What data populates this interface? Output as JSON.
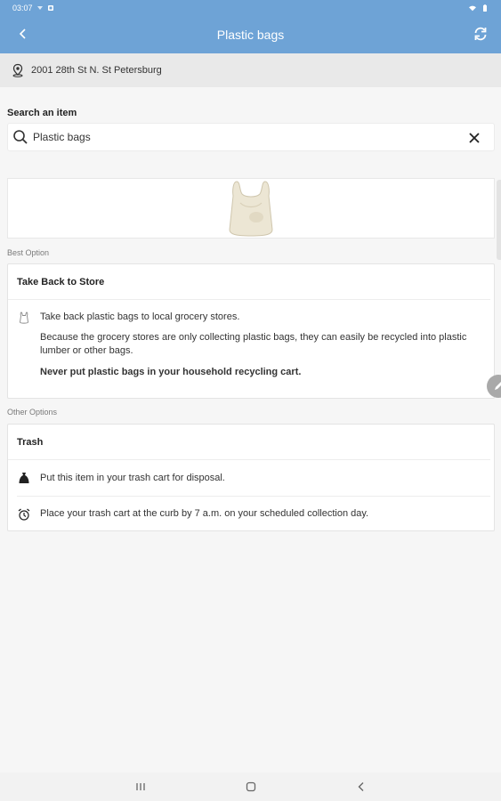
{
  "status_bar": {
    "time": "03:07"
  },
  "app_bar": {
    "title": "Plastic bags"
  },
  "address": {
    "text": "2001 28th St N. St Petersburg"
  },
  "search": {
    "label": "Search an item",
    "value": "Plastic bags",
    "placeholder": ""
  },
  "best_option": {
    "section_label": "Best Option",
    "title": "Take Back to Store",
    "line1": "Take back plastic bags to local grocery stores.",
    "line2": "Because the grocery stores are only collecting plastic bags, they can easily be recycled into plastic lumber or other bags.",
    "line3": "Never put plastic bags in your household recycling cart."
  },
  "other_options": {
    "section_label": "Other Options",
    "title": "Trash",
    "row1": "Put this item in your trash cart for disposal.",
    "row2": "Place your trash cart at the curb by 7 a.m. on your scheduled collection day."
  },
  "icons": {
    "back": "arrow-left",
    "refresh": "refresh",
    "pin": "location-pin",
    "search": "magnifier",
    "clear": "close",
    "bag": "plastic-bag-outline",
    "trash": "trash-bag",
    "alarm": "alarm-clock",
    "edit": "pencil"
  },
  "colors": {
    "accent": "#6ea3d6",
    "background": "#f6f6f6"
  }
}
